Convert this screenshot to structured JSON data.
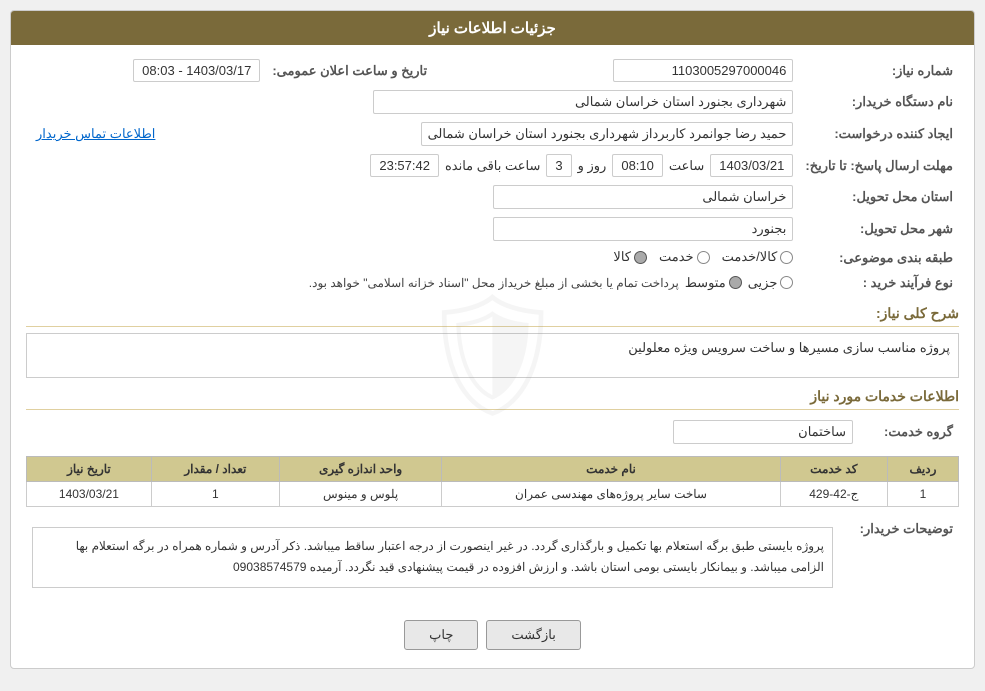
{
  "header": {
    "title": "جزئیات اطلاعات نیاز"
  },
  "fields": {
    "need_number_label": "شماره نیاز:",
    "need_number_value": "1103005297000046",
    "announcement_date_label": "تاریخ و ساعت اعلان عمومی:",
    "announcement_date_value": "1403/03/17 - 08:03",
    "buyer_label": "نام دستگاه خریدار:",
    "buyer_value": "شهرداری بجنورد استان خراسان شمالی",
    "creator_label": "ایجاد کننده درخواست:",
    "creator_value": "حمید رضا جوانمرد کاربرداز شهرداری بجنورد استان خراسان شمالی",
    "contact_link": "اطلاعات تماس خریدار",
    "deadline_label": "مهلت ارسال پاسخ: تا تاریخ:",
    "deadline_date": "1403/03/21",
    "deadline_time_label": "ساعت",
    "deadline_time": "08:10",
    "deadline_day_label": "روز و",
    "deadline_days": "3",
    "deadline_remaining_label": "ساعت باقی مانده",
    "deadline_remaining": "23:57:42",
    "province_label": "استان محل تحویل:",
    "province_value": "خراسان شمالی",
    "city_label": "شهر محل تحویل:",
    "city_value": "بجنورد",
    "category_label": "طبقه بندی موضوعی:",
    "category_options": [
      "کالا",
      "خدمت",
      "کالا/خدمت"
    ],
    "category_selected": "کالا",
    "process_label": "نوع فرآیند خرید :",
    "process_options": [
      "جزیی",
      "متوسط"
    ],
    "process_selected": "متوسط",
    "process_note": "پرداخت تمام یا بخشی از مبلغ خریداز محل \"اسناد خزانه اسلامی\" خواهد بود.",
    "description_label": "شرح کلی نیاز:",
    "description_value": "پروژه مناسب سازی مسیرها و ساخت سرویس ویژه معلولین",
    "services_section_title": "اطلاعات خدمات مورد نیاز",
    "service_group_label": "گروه خدمت:",
    "service_group_value": "ساختمان",
    "services_table": {
      "headers": [
        "ردیف",
        "کد خدمت",
        "نام خدمت",
        "واحد اندازه گیری",
        "تعداد / مقدار",
        "تاریخ نیاز"
      ],
      "rows": [
        {
          "row": "1",
          "code": "ج-42-429",
          "name": "ساخت سایر پروژه‌های مهندسی عمران",
          "unit": "پلوس و مینوس",
          "quantity": "1",
          "date": "1403/03/21"
        }
      ]
    },
    "buyer_notes_label": "توضیحات خریدار:",
    "buyer_notes_value": "پروژه بایستی طبق برگه استعلام بها  تکمیل و بارگذاری گردد. در غیر اینصورت از درجه اعتبار ساقط میباشد. ذکر آدرس و شماره همراه در برگه استعلام بها الزامی میباشد. و بیمانکار بایستی بومی استان باشد.  و ارزش افزوده در قیمت پیشنهادی قید نگردد. آرمیده 09038574579"
  },
  "buttons": {
    "print_label": "چاپ",
    "back_label": "بازگشت"
  }
}
